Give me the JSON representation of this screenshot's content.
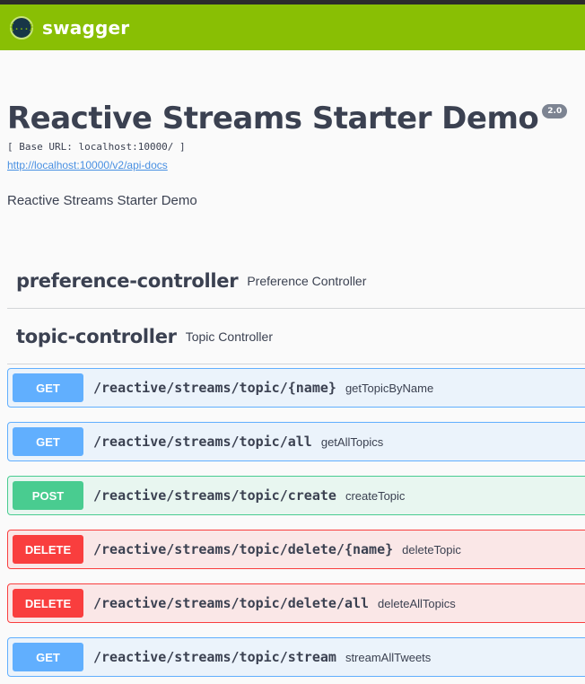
{
  "header": {
    "logo_glyph": "{...}",
    "logo_text": "swagger",
    "colors": {
      "bar": "#89bf04",
      "logo_circle": "#173647"
    }
  },
  "info": {
    "title": "Reactive Streams Starter Demo",
    "version": "2.0",
    "base_url": "[ Base URL: localhost:10000/ ]",
    "spec_link": "http://localhost:10000/v2/api-docs",
    "description": "Reactive Streams Starter Demo"
  },
  "tags": [
    {
      "name": "preference-controller",
      "description": "Preference Controller"
    },
    {
      "name": "topic-controller",
      "description": "Topic Controller"
    }
  ],
  "operations": [
    {
      "method": "GET",
      "path": "/reactive/streams/topic/{name}",
      "operation_id": "getTopicByName"
    },
    {
      "method": "GET",
      "path": "/reactive/streams/topic/all",
      "operation_id": "getAllTopics"
    },
    {
      "method": "POST",
      "path": "/reactive/streams/topic/create",
      "operation_id": "createTopic"
    },
    {
      "method": "DELETE",
      "path": "/reactive/streams/topic/delete/{name}",
      "operation_id": "deleteTopic"
    },
    {
      "method": "DELETE",
      "path": "/reactive/streams/topic/delete/all",
      "operation_id": "deleteAllTopics"
    },
    {
      "method": "GET",
      "path": "/reactive/streams/topic/stream",
      "operation_id": "streamAllTweets"
    }
  ],
  "method_colors": {
    "GET": "#61affe",
    "POST": "#49cc90",
    "DELETE": "#f93e3e"
  }
}
